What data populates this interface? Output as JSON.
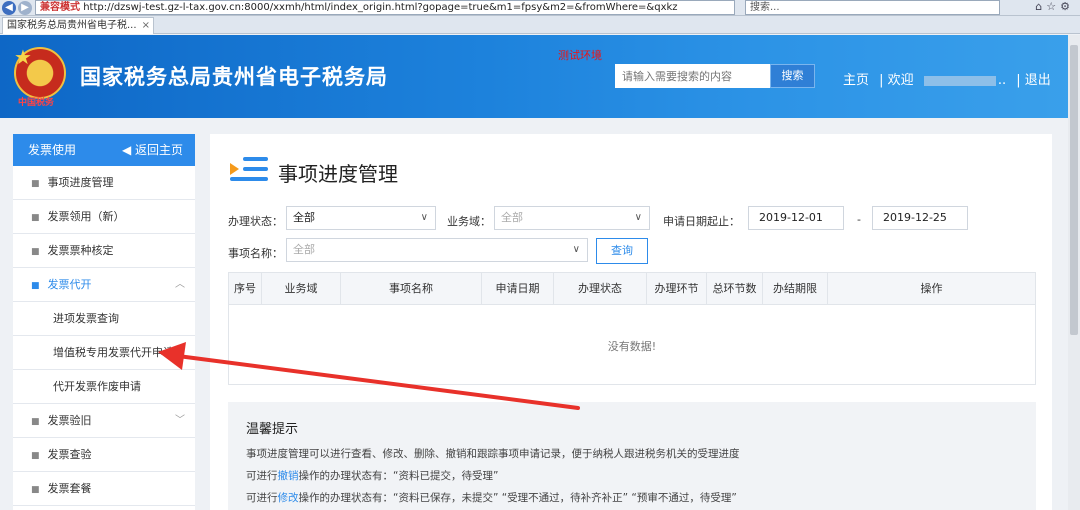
{
  "browser": {
    "address": "http://dzswj-test.gz-l-tax.gov.cn:8000/xxmh/html/index_origin.html?gopage=true&m1=fpsy&m2=&fromWhere=&qxkz",
    "compat_label": "兼容模式",
    "search_placeholder": "搜索...",
    "tab_title": "国家税务总局贵州省电子税...",
    "tab_close": "×"
  },
  "header": {
    "site_title": "国家税务总局贵州省电子税务局",
    "test_env": "测试环境",
    "search_placeholder": "请输入需要搜索的内容",
    "search_button": "搜索",
    "home_link": "主页",
    "welcome": "| 欢迎",
    "ellipsis": "..",
    "logout": "| 退出",
    "emblem_text": "中国税务"
  },
  "sidebar": {
    "heading": "发票使用",
    "back_home": "返回主页",
    "items": [
      {
        "label": "事项进度管理"
      },
      {
        "label": "发票领用（新）"
      },
      {
        "label": "发票票种核定"
      },
      {
        "label": "发票代开"
      },
      {
        "label": "进项发票查询"
      },
      {
        "label": "增值税专用发票代开申请"
      },
      {
        "label": "代开发票作废申请"
      },
      {
        "label": "发票验旧"
      },
      {
        "label": "发票查验"
      },
      {
        "label": "发票套餐"
      }
    ]
  },
  "main": {
    "page_title": "事项进度管理",
    "filters": {
      "status_label": "办理状态：",
      "status_value": "全部",
      "domain_label": "业务域：",
      "domain_placeholder": "全部",
      "date_label": "申请日期起止：",
      "date_start": "2019-12-01",
      "date_sep": "-",
      "date_end": "2019-12-25",
      "item_label": "事项名称：",
      "item_placeholder": "全部",
      "query_button": "查询"
    },
    "table": {
      "columns": [
        "序号",
        "业务域",
        "事项名称",
        "申请日期",
        "办理状态",
        "办理环节",
        "总环节数",
        "办结期限",
        "操作"
      ],
      "empty_text": "没有数据!"
    },
    "tips": {
      "title": "温馨提示",
      "line1": "事项进度管理可以进行查看、修改、删除、撤销和跟踪事项申请记录，便于纳税人跟进税务机关的受理进度",
      "line2_prefix": "可进行",
      "line2_link": "撤销",
      "line2_suffix": "操作的办理状态有：“资料已提交，待受理”",
      "line3_prefix": "可进行",
      "line3_link": "修改",
      "line3_suffix": "操作的办理状态有：“资料已保存，未提交” “受理不通过，待补齐补正” “预审不通过，待受理”"
    }
  },
  "colors": {
    "brand_blue": "#2d8bea",
    "header_blue": "#1d82dc",
    "accent_orange": "#f59a1b",
    "annotation_red": "#e8312a"
  }
}
